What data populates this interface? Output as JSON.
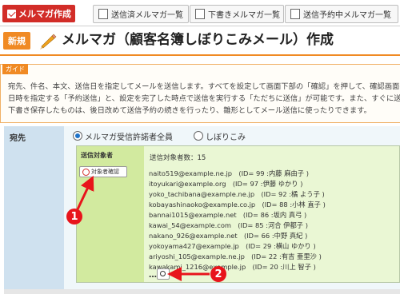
{
  "topbar": {
    "brand_label": "メルマガ作成",
    "tabs": [
      {
        "label": "送信済メルマガ一覧"
      },
      {
        "label": "下書きメルマガ一覧"
      },
      {
        "label": "送信予約中メルマガ一覧"
      }
    ]
  },
  "header": {
    "badge": "新規",
    "title": "メルマガ（顧客名簿しぼりこみメール）作成"
  },
  "guide": {
    "tag": "ガイド",
    "lines": [
      "宛先、件名、本文、送信日を指定してメールを送信します。すべてを設定して画面下部の「確認」を押して、確認画面へ進",
      "日時を指定する「予約送信」と、設定を完了した時点で送信を実行する「ただちに送信」が可能です。また、すぐに送信せ",
      "下書き保存したものは、後日改めて送信予約の続きを行ったり、雛形としてメール送信に使ったりできます。"
    ]
  },
  "destination": {
    "label": "宛先",
    "options": [
      {
        "label": "メルマガ受信許諾者全員",
        "selected": true
      },
      {
        "label": "しぼりこみ",
        "selected": false
      }
    ],
    "recipients_title": "送信対象者",
    "check_button": "対象者確認",
    "count_text": "送信対象者数：15",
    "recipients": [
      "naito519@example.ne.jp　(ID= 99 :内藤 麻由子 )",
      "itoyukari@example.org　(ID= 97 :伊藤 ゆかり )",
      "yoko_tachibana@example.ne.jp　(ID= 92 :橘 よう子 )",
      "kobayashinaoko@example.co.jp　(ID= 88 :小林 直子 )",
      "bannai1015@example.net　(ID= 86 :坂内 真弓 )",
      "kawai_54@example.com　(ID= 85 :河合 伊都子 )",
      "nakano_926@example.net　(ID= 66 :中野 真紀 )",
      "yokoyama427@example.jp　(ID= 29 :横山 ゆかり )",
      "ariyoshi_105@example.ne.jp　(ID= 22 :有吉 亜里沙 )",
      "kawakami_1216@example.jp　(ID= 20 :川上 智子 )"
    ],
    "ellipsis": "…"
  },
  "callouts": [
    "1",
    "2"
  ],
  "colors": {
    "brand_red": "#d22d28",
    "accent_orange": "#f08a24",
    "callout_red": "#e8141b",
    "label_blue": "#cfe1ef",
    "recipient_green": "#d2ea9f"
  }
}
